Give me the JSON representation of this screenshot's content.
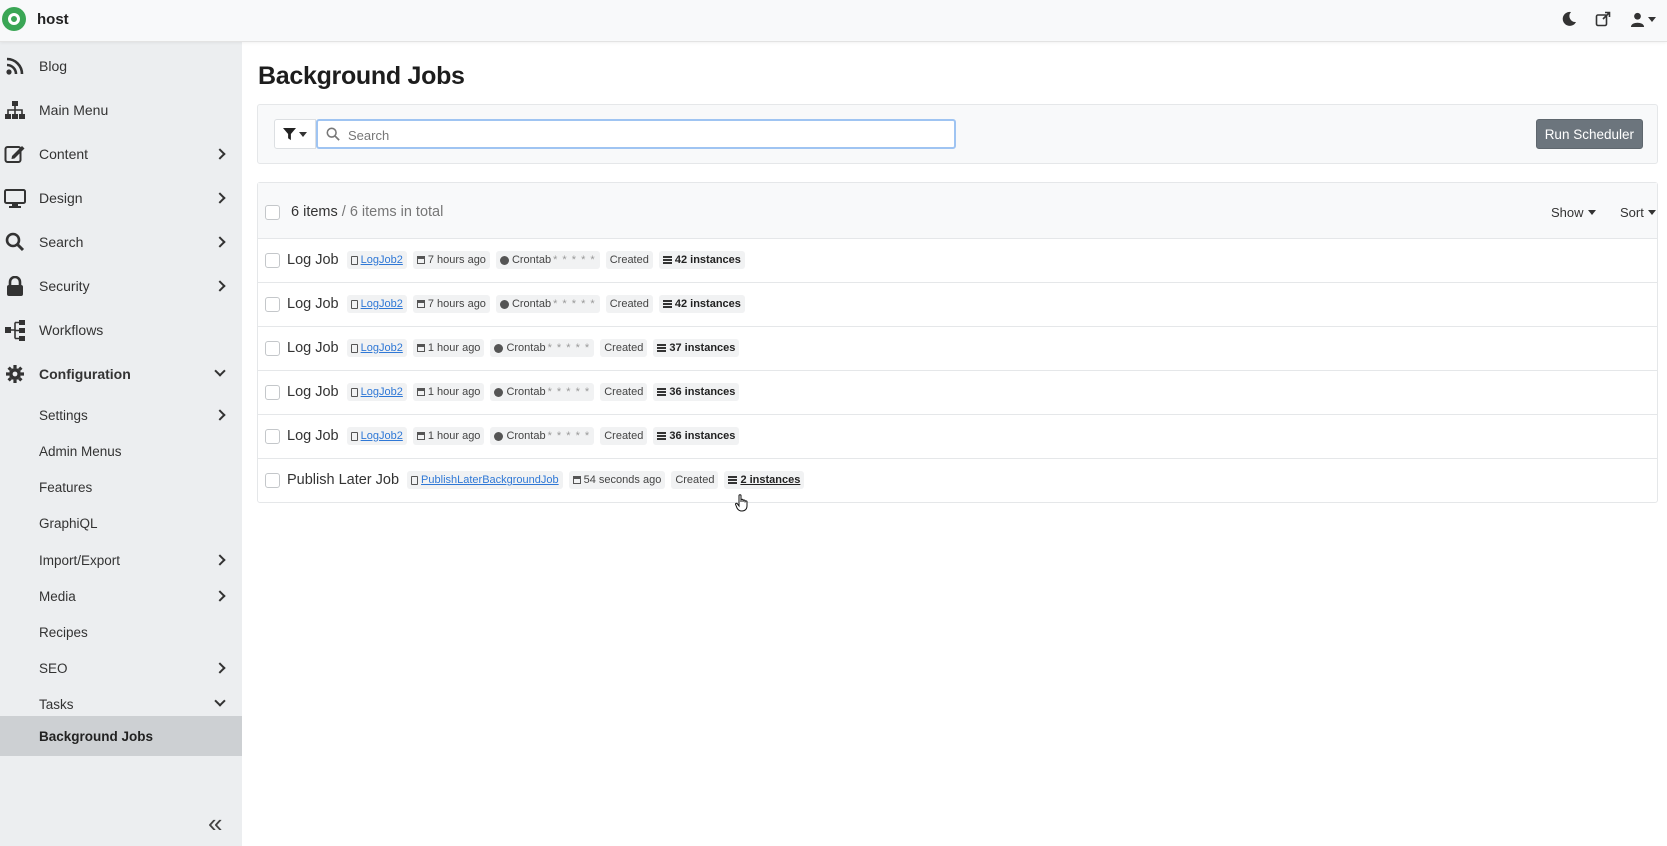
{
  "app": {
    "site_name": "host"
  },
  "sidebar": {
    "items": [
      {
        "label": "Blog",
        "icon": "rss-icon"
      },
      {
        "label": "Main Menu",
        "icon": "sitemap-icon"
      },
      {
        "label": "Content",
        "icon": "edit-icon"
      },
      {
        "label": "Design",
        "icon": "desktop-icon"
      },
      {
        "label": "Search",
        "icon": "search-icon"
      },
      {
        "label": "Security",
        "icon": "lock-icon"
      },
      {
        "label": "Workflows",
        "icon": "workflow-icon"
      },
      {
        "label": "Configuration",
        "icon": "gear-icon"
      },
      {
        "label": "Settings"
      },
      {
        "label": "Admin Menus"
      },
      {
        "label": "Features"
      },
      {
        "label": "GraphiQL"
      },
      {
        "label": "Import/Export"
      },
      {
        "label": "Media"
      },
      {
        "label": "Recipes"
      },
      {
        "label": "SEO"
      },
      {
        "label": "Tasks"
      },
      {
        "label": "Background Jobs"
      }
    ]
  },
  "page": {
    "title": "Background Jobs"
  },
  "toolbar": {
    "search_placeholder": "Search",
    "run_scheduler_label": "Run Scheduler"
  },
  "list": {
    "count_label": "6 items",
    "total_label": " / 6 items in total",
    "show_label": "Show",
    "sort_label": "Sort",
    "rows": [
      {
        "title": "Log Job",
        "type": "LogJob2",
        "time": "7 hours ago",
        "schedule": "Crontab",
        "stars": "* * * * *",
        "status": "Created",
        "instances": "42 instances"
      },
      {
        "title": "Log Job",
        "type": "LogJob2",
        "time": "7 hours ago",
        "schedule": "Crontab",
        "stars": "* * * * *",
        "status": "Created",
        "instances": "42 instances"
      },
      {
        "title": "Log Job",
        "type": "LogJob2",
        "time": "1 hour ago",
        "schedule": "Crontab",
        "stars": "* * * * *",
        "status": "Created",
        "instances": "37 instances"
      },
      {
        "title": "Log Job",
        "type": "LogJob2",
        "time": "1 hour ago",
        "schedule": "Crontab",
        "stars": "* * * * *",
        "status": "Created",
        "instances": "36 instances"
      },
      {
        "title": "Log Job",
        "type": "LogJob2",
        "time": "1 hour ago",
        "schedule": "Crontab",
        "stars": "* * * * *",
        "status": "Created",
        "instances": "36 instances"
      },
      {
        "title": "Publish Later Job",
        "type": "PublishLaterBackgroundJob",
        "time": "54 seconds ago",
        "status": "Created",
        "instances": "2 instances"
      }
    ]
  },
  "colors": {
    "accent": "#3aa655",
    "link": "#2f78d6",
    "button": "#6c757d"
  }
}
